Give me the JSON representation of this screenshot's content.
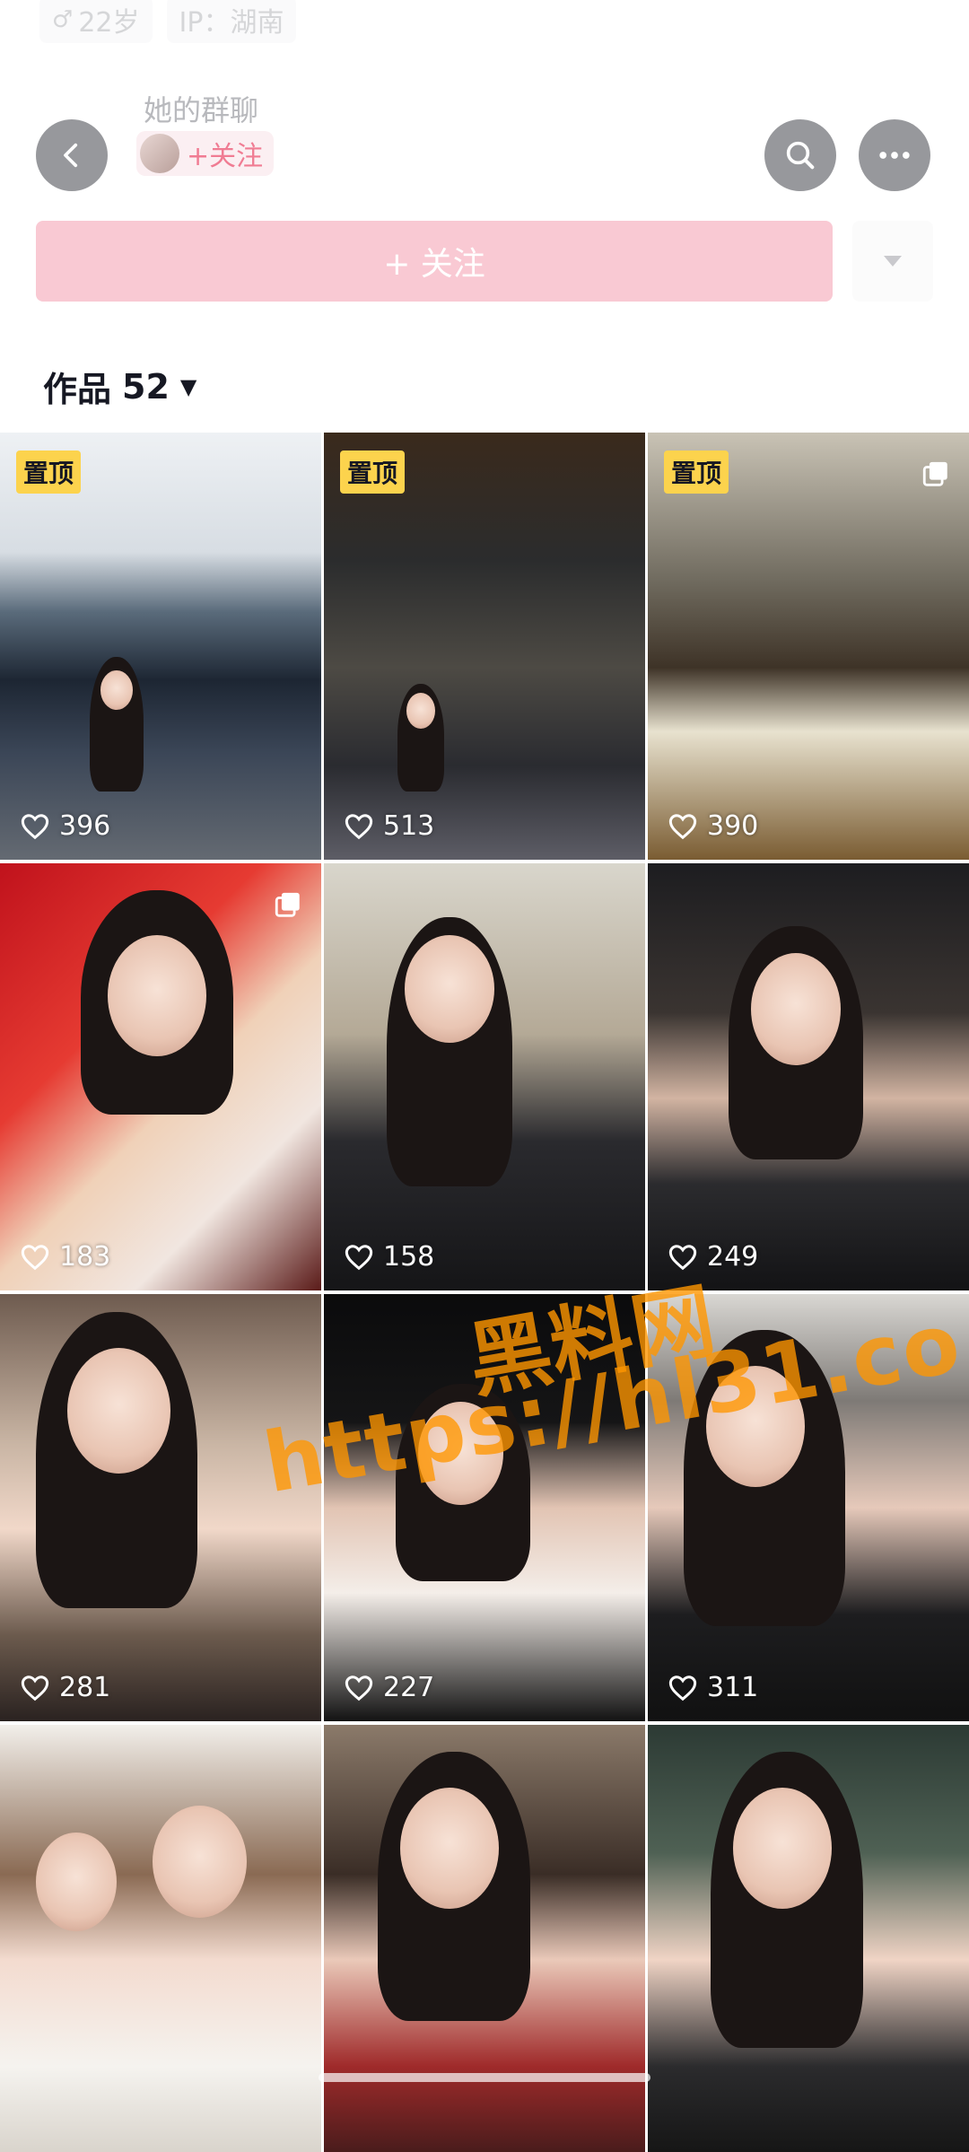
{
  "profile_meta": {
    "age": "22岁",
    "ip": "IP：湖南"
  },
  "header": {
    "group_title": "她的群聊",
    "mini_follow_label": "+关注"
  },
  "follow_button": {
    "label": "+ 关注"
  },
  "works_tab": {
    "label": "作品",
    "count": "52"
  },
  "videos": [
    {
      "pinned": "置顶",
      "likes": "396"
    },
    {
      "pinned": "置顶",
      "likes": "513"
    },
    {
      "pinned": "置顶",
      "likes": "390",
      "multi": true
    },
    {
      "likes": "183",
      "multi": true
    },
    {
      "likes": "158"
    },
    {
      "likes": "249"
    },
    {
      "likes": "281"
    },
    {
      "likes": "227"
    },
    {
      "likes": "311"
    },
    {
      "likes": ""
    },
    {
      "likes": ""
    },
    {
      "likes": ""
    }
  ],
  "watermark": {
    "cn": "黑料网",
    "url": "https://hl31.co"
  },
  "colors": {
    "accent_pink": "#f9c9d3",
    "pin_yellow": "#fcd34d"
  }
}
